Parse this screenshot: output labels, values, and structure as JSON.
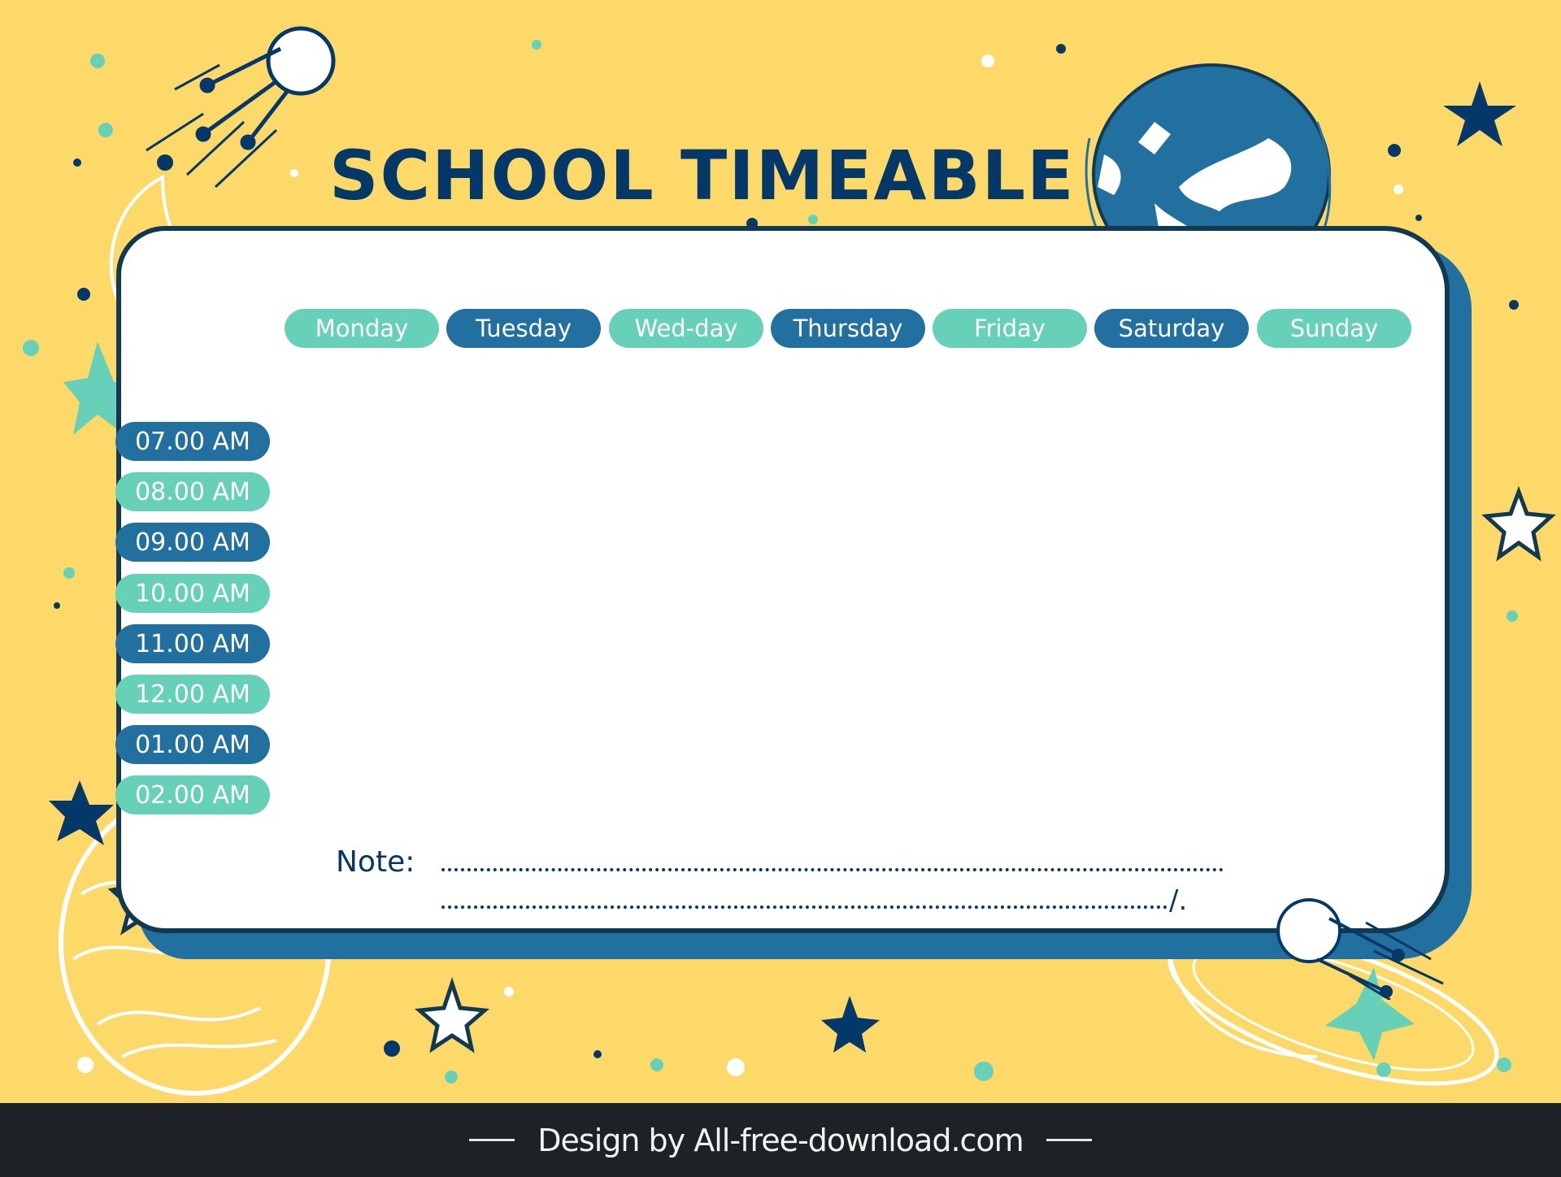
{
  "title": "SCHOOL TIMEABLE",
  "colors": {
    "background": "#FDD969",
    "navy": "#043869",
    "blue": "#2270A0",
    "teal": "#66D0B8",
    "outline": "#113A52",
    "footer": "#1E2126"
  },
  "days": [
    {
      "label": "Monday",
      "style": "teal"
    },
    {
      "label": "Tuesday",
      "style": "blue"
    },
    {
      "label": "Wed-day",
      "style": "teal"
    },
    {
      "label": "Thursday",
      "style": "blue"
    },
    {
      "label": "Friday",
      "style": "teal"
    },
    {
      "label": "Saturday",
      "style": "blue"
    },
    {
      "label": "Sunday",
      "style": "teal"
    }
  ],
  "times": [
    {
      "label": "07.00 AM",
      "style": "blue"
    },
    {
      "label": "08.00 AM",
      "style": "teal"
    },
    {
      "label": "09.00 AM",
      "style": "blue"
    },
    {
      "label": "10.00 AM",
      "style": "teal"
    },
    {
      "label": "11.00 AM",
      "style": "blue"
    },
    {
      "label": "12.00 AM",
      "style": "teal"
    },
    {
      "label": "01.00 AM",
      "style": "blue"
    },
    {
      "label": "02.00 AM",
      "style": "teal"
    }
  ],
  "note": {
    "label": "Note:",
    "end_mark": "/."
  },
  "footer": {
    "text": "Design by All-free-download.com"
  },
  "decorations": [
    "satellite-icon",
    "moon-icon",
    "earth-icon",
    "planet-icon",
    "ringed-planet-icon",
    "star-icon"
  ]
}
